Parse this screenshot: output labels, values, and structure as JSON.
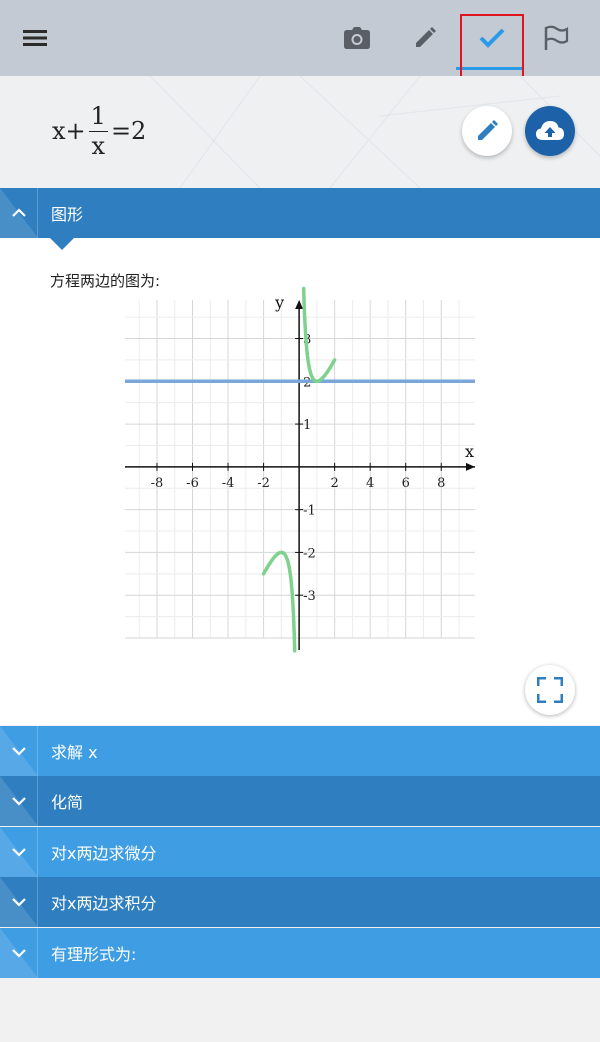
{
  "toolbar": {
    "icons": [
      "menu-icon",
      "camera-icon",
      "pencil-icon",
      "checkmark-icon",
      "flag-icon"
    ],
    "active": "checkmark-icon",
    "accent": "#2a9be8",
    "highlight_color": "#e0141c"
  },
  "equation": {
    "lhs_var": "x+",
    "frac_num": "1",
    "frac_den": "x",
    "rhs": "=2"
  },
  "sections": [
    {
      "label": "图形",
      "expanded": true
    },
    {
      "label": "求解 x",
      "expanded": false
    },
    {
      "label": "化简",
      "expanded": false
    },
    {
      "label": "对x两边求微分",
      "expanded": false
    },
    {
      "label": "对x两边求积分",
      "expanded": false
    },
    {
      "label": "有理形式为:",
      "expanded": false
    }
  ],
  "graph_section": {
    "caption": "方程两边的图为:"
  },
  "chart_data": {
    "type": "line",
    "xlabel": "x",
    "ylabel": "y",
    "xlim": [
      -9.8,
      9.9
    ],
    "ylim": [
      -4.0,
      3.9
    ],
    "grid": true,
    "x_ticks": [
      -8,
      -6,
      -4,
      -2,
      2,
      4,
      6,
      8
    ],
    "y_ticks": [
      -3,
      -2,
      -1,
      1,
      2,
      3
    ],
    "series": [
      {
        "expression": "x+1/x",
        "color": "#7fd18e",
        "domain": [
          -2,
          2
        ]
      },
      {
        "expression": "2",
        "color": "#7aa6d8",
        "domain": [
          -9.8,
          9.9
        ]
      }
    ]
  }
}
